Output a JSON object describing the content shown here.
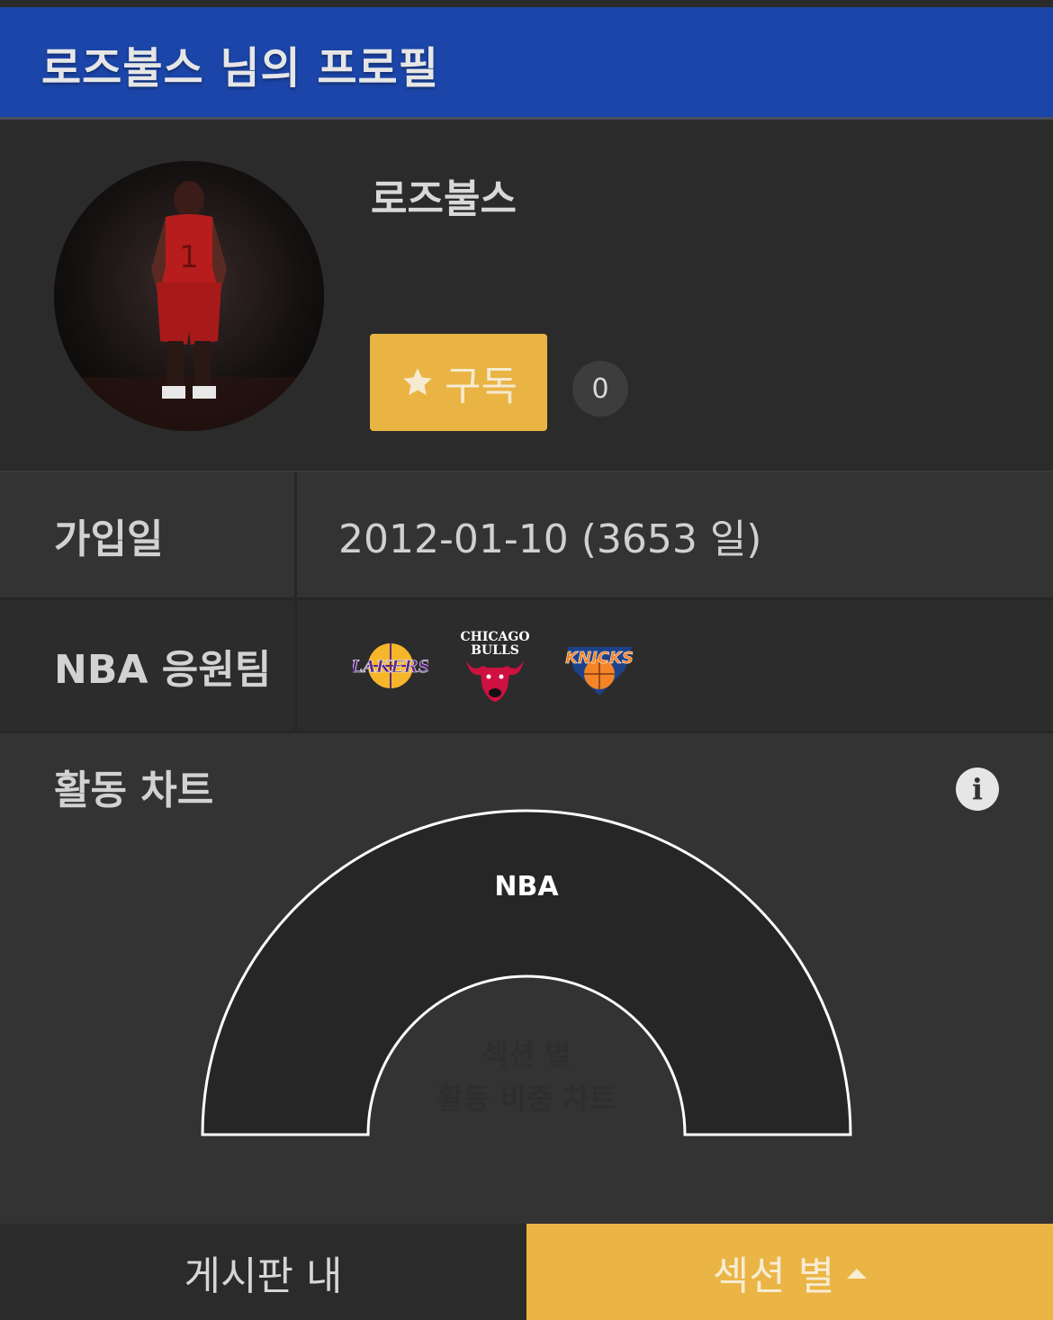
{
  "header": {
    "title": "로즈불스 님의 프로필"
  },
  "profile": {
    "username": "로즈불스",
    "subscribe_label": "구독",
    "subscriber_count": "0",
    "avatar_icon": "avatar-photo"
  },
  "info_rows": {
    "join": {
      "label": "가입일",
      "value": "2012-01-10 (3653 일)"
    },
    "teams": {
      "label": "NBA 응원팀",
      "logos": [
        "lakers-logo",
        "bulls-logo",
        "knicks-logo"
      ]
    }
  },
  "activity": {
    "title": "활동 차트",
    "info_icon": "info-icon"
  },
  "chart_data": {
    "type": "pie",
    "categories": [
      "NBA"
    ],
    "values": [
      100
    ],
    "center_label_line1": "섹션 별",
    "center_label_line2": "활동 비중 차트"
  },
  "bottom_tabs": {
    "board": "게시판 내",
    "section": "섹션 별"
  },
  "colors": {
    "header_bg": "#1b45a8",
    "accent": "#eab545",
    "page_bg": "#333333"
  }
}
